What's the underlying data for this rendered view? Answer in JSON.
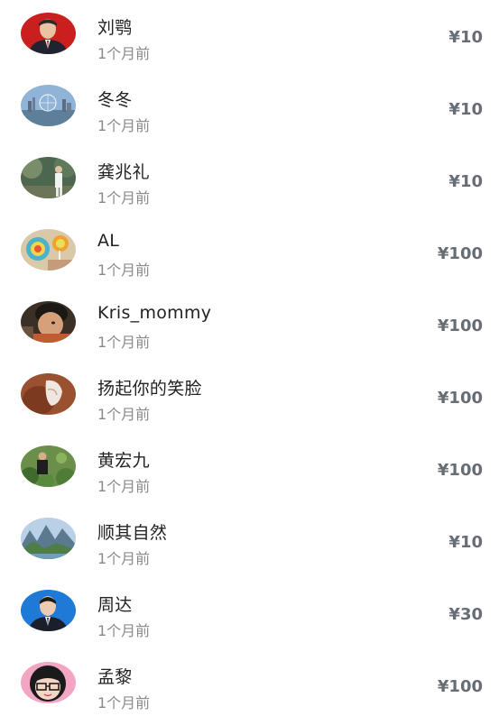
{
  "donations": [
    {
      "name": "刘鹗",
      "time": "1个月前",
      "amount": "¥10",
      "avatar": "man-in-suit-red-background"
    },
    {
      "name": "冬冬",
      "time": "1个月前",
      "amount": "¥10",
      "avatar": "city-skyline-ferris-wheel"
    },
    {
      "name": "龚兆礼",
      "time": "1个月前",
      "amount": "¥10",
      "avatar": "man-in-garden"
    },
    {
      "name": "AL",
      "time": "1个月前",
      "amount": "¥100",
      "avatar": "lollipops"
    },
    {
      "name": "Kris_mommy",
      "time": "1个月前",
      "amount": "¥100",
      "avatar": "child-portrait"
    },
    {
      "name": "扬起你的笑脸",
      "time": "1个月前",
      "amount": "¥100",
      "avatar": "hands-brown"
    },
    {
      "name": "黄宏九",
      "time": "1个月前",
      "amount": "¥100",
      "avatar": "man-in-plants"
    },
    {
      "name": "顺其自然",
      "time": "1个月前",
      "amount": "¥10",
      "avatar": "mountain-landscape"
    },
    {
      "name": "周达",
      "time": "1个月前",
      "amount": "¥30",
      "avatar": "man-in-suit-blue-background"
    },
    {
      "name": "孟黎",
      "time": "1个月前",
      "amount": "¥100",
      "avatar": "cartoon-girl-glasses"
    }
  ]
}
